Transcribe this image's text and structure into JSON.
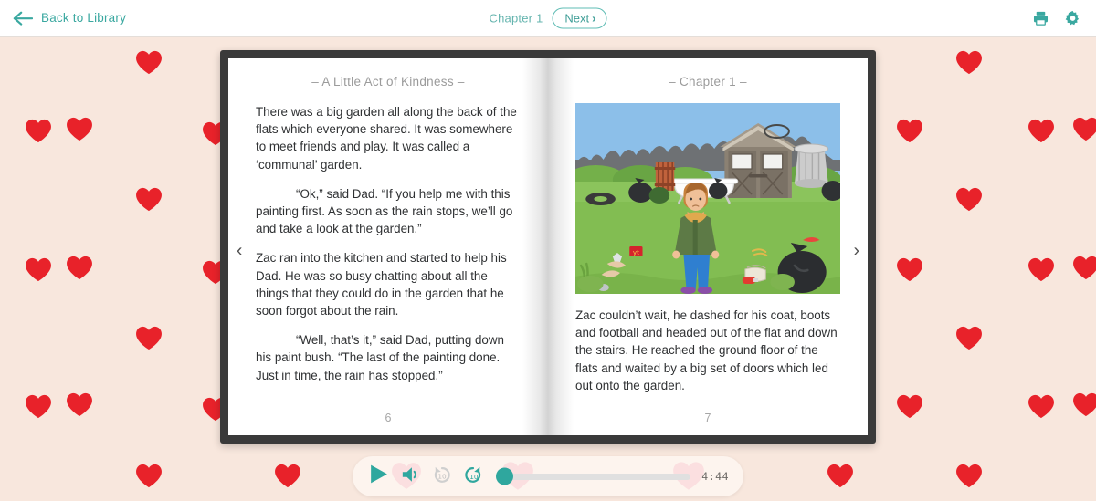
{
  "topbar": {
    "back_label": "Back to Library",
    "back_icon": "arrow-left-icon",
    "chapter_label": "Chapter 1",
    "next_label": "Next",
    "next_chevron": "›",
    "print_icon": "printer-icon",
    "settings_icon": "gear-icon",
    "accent_color": "#3aa8a0"
  },
  "book": {
    "prev_arrow": "‹",
    "next_arrow": "›",
    "left_page": {
      "title": "– A Little Act of Kindness –",
      "paragraphs": [
        "There was a big garden all along the back of the flats which everyone shared. It was somewhere to meet friends and play. It was called a ‘communal’ garden.",
        "“Ok,” said Dad. “If you help me with this painting first. As soon as the rain stops, we’ll go and take a look at the garden.”",
        "Zac ran into the kitchen and started to help his Dad. He was so busy chatting about all the things that they could do in the garden that he soon forgot about the rain.",
        "“Well, that’s it,” said Dad, putting down his paint bush. “The last of the painting done. Just in time, the rain has stopped.”"
      ],
      "page_number": "6"
    },
    "right_page": {
      "title": "– Chapter 1 –",
      "illustration_name": "boy-in-littered-garden-illustration",
      "paragraphs": [
        "Zac couldn’t wait, he dashed for his coat, boots and football and headed out of the flat and down the stairs. He reached the ground floor of the flats and waited by a big set of doors which led out onto the garden."
      ],
      "page_number": "7"
    }
  },
  "player": {
    "play_icon": "play-icon",
    "volume_icon": "volume-icon",
    "rewind_icon": "rewind-10-icon",
    "rewind_value": "10",
    "forward_icon": "forward-10-icon",
    "forward_value": "10",
    "time_remaining": "4:44",
    "progress_percent": 0,
    "accent_color": "#2fa79e"
  },
  "background": {
    "pattern": "red-hearts",
    "heart_color": "#e8222a",
    "page_color": "#f8e7dd"
  }
}
